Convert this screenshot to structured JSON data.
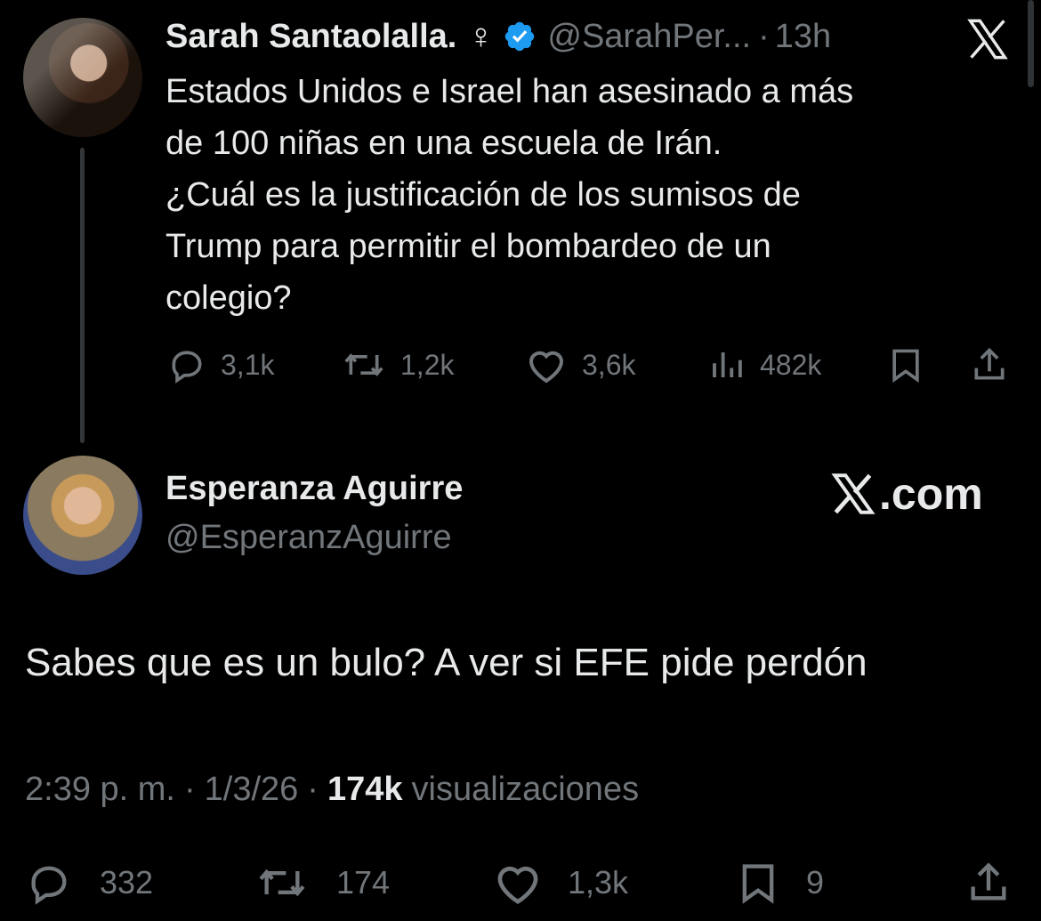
{
  "parent_tweet": {
    "author_name": "Sarah Santaolalla.",
    "author_symbol": "♀",
    "author_handle": "@SarahPer...",
    "separator": "·",
    "time_ago": "13h",
    "text": "Estados Unidos e Israel han asesinado a más\nde 100 niñas en una escuela de Irán.\n¿Cuál es la justificación de los sumisos de\nTrump para permitir el bombardeo de un\ncolegio?",
    "actions": {
      "replies": "3,1k",
      "reposts": "1,2k",
      "likes": "3,6k",
      "views": "482k"
    }
  },
  "reply_tweet": {
    "author_name": "Esperanza Aguirre",
    "author_handle": "@EsperanzAguirre",
    "watermark": ".com",
    "text": "Sabes que es un bulo? A ver si EFE pide perdón",
    "timestamp": "2:39 p. m.",
    "separator": "·",
    "date": "1/3/26",
    "views_count": "174k",
    "views_label": "visualizaciones",
    "actions": {
      "replies": "332",
      "reposts": "174",
      "likes": "1,3k",
      "bookmarks": "9"
    }
  },
  "colors": {
    "background": "#000000",
    "text_primary": "#e7e9ea",
    "text_secondary": "#71767b",
    "verified_blue": "#1d9bf0",
    "thread_line": "#333639"
  },
  "icons": {
    "close": "x-logo-icon",
    "verified": "verified-badge-icon",
    "reply": "reply-icon",
    "repost": "repost-icon",
    "like": "heart-icon",
    "views": "views-chart-icon",
    "bookmark": "bookmark-icon",
    "share": "share-icon"
  }
}
